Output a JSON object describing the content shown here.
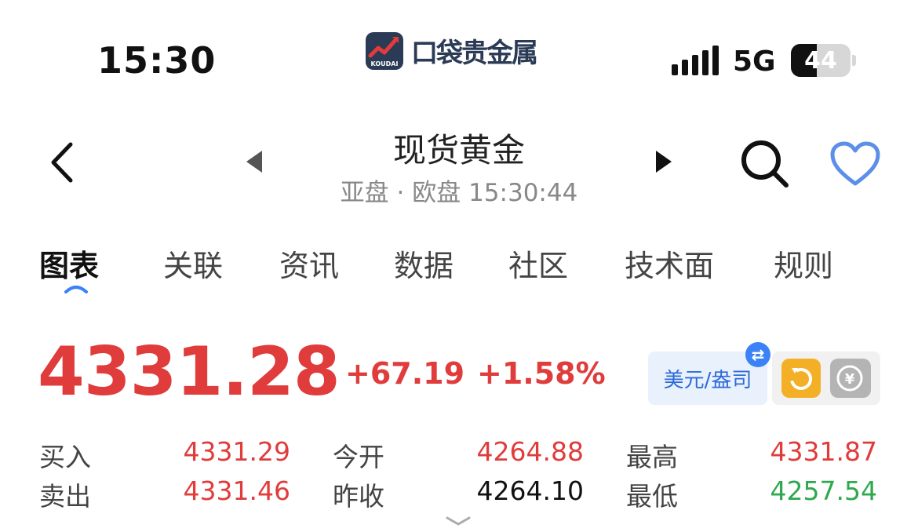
{
  "status_bar": {
    "time": "15:30",
    "network": "5G",
    "battery": "44",
    "battery_level": 0.44
  },
  "app_logo": {
    "badge_text": "KOUDAI",
    "name": "口袋贵金属"
  },
  "header": {
    "title": "现货黄金",
    "subtitle": "亚盘 · 欧盘 15:30:44"
  },
  "tabs": [
    {
      "label": "图表",
      "active": true
    },
    {
      "label": "关联"
    },
    {
      "label": "资讯"
    },
    {
      "label": "数据"
    },
    {
      "label": "社区"
    },
    {
      "label": "技术面"
    },
    {
      "label": "规则"
    }
  ],
  "quote": {
    "price": "4331.28",
    "change": "+67.19",
    "change_pct": "+1.58%",
    "currency_button": "美元/盎司",
    "swap_icon": "swap-icon",
    "refresh_icon": "refresh-icon",
    "coin_icon": "yuan-coin-icon"
  },
  "stats": {
    "buy_label": "买入",
    "buy": "4331.29",
    "sell_label": "卖出",
    "sell": "4331.46",
    "open_label": "今开",
    "open": "4264.88",
    "prev_close_label": "昨收",
    "prev_close": "4264.10",
    "high_label": "最高",
    "high": "4331.87",
    "low_label": "最低",
    "low": "4257.54"
  },
  "colors": {
    "up": "#e03c3c",
    "down": "#2fa84f",
    "accent": "#2e6bd8",
    "heart": "#5b8fe8"
  }
}
